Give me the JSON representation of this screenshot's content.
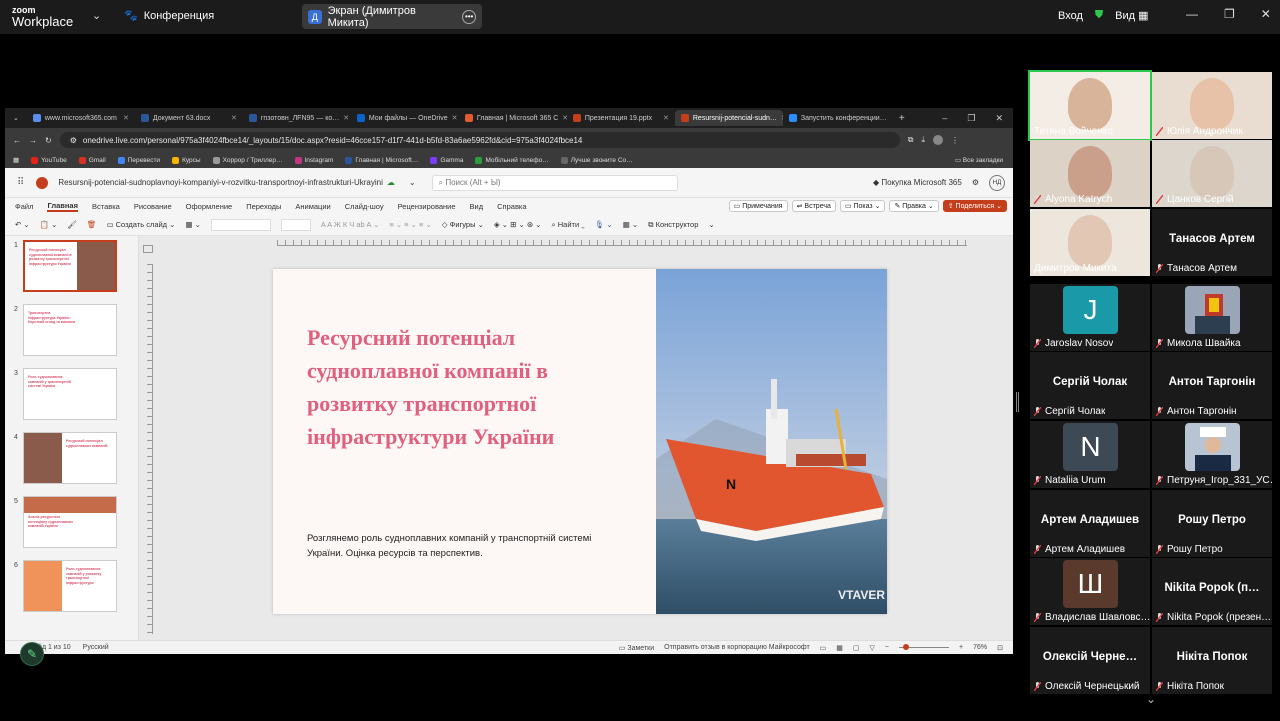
{
  "zoom": {
    "logo_line1": "zoom",
    "logo_line2": "Workplace",
    "conference_label": "Конференция",
    "screen_badge": "Д",
    "screen_share_label": "Экран (Димитров Микита)",
    "enter_label": "Вход",
    "view_label": "Вид"
  },
  "browser": {
    "tabs": [
      {
        "label": "www.microsoft365.com",
        "color": "#5b8def"
      },
      {
        "label": "Документ 63.docx",
        "color": "#2b579a"
      },
      {
        "label": "гпзотовн_ЛFN95 — ко…",
        "color": "#2b579a"
      },
      {
        "label": "Мои файлы — OneDrive",
        "color": "#0a63c9"
      },
      {
        "label": "Главная | Microsoft 365 С",
        "color": "#e35b2c"
      },
      {
        "label": "Презентация 19.pptx",
        "color": "#c43e1c"
      },
      {
        "label": "Resursnij-potencial-sudn…",
        "color": "#c43e1c"
      },
      {
        "label": "Запустить конференции…",
        "color": "#2d8cff"
      }
    ],
    "url": "onedrive.live.com/personal/975a3f4024fbce14/_layouts/15/doc.aspx?resid=46cce157-d1f7-441d-b5fd-83a6ae5962fd&cid=975a3f4024fbce14",
    "bookmarks": [
      "YouTube",
      "Gmail",
      "Перевести",
      "Курсы",
      "Хоррор / Триллер…",
      "Instagram",
      "Главная | Microsoft…",
      "Gamma",
      "Мобільний телефо…",
      "Лучше звоните Со…"
    ],
    "all_bookmarks": "Все закладки"
  },
  "office": {
    "doc_title": "Resursnij-potencial-sudnoplavnoyi-kompaniyi-v-rozvitku-transportnoyi-infrastrukturi-Ukrayini",
    "search_placeholder": "Поиск (Alt + Ы)",
    "buy_label": "Покупка Microsoft 365",
    "user_initials": "НД",
    "menu": [
      "Файл",
      "Главная",
      "Вставка",
      "Рисование",
      "Оформление",
      "Переходы",
      "Анимации",
      "Слайд-шоу",
      "Рецензирование",
      "Вид",
      "Справка"
    ],
    "notes_btn": "Примечания",
    "meeting_btn": "Встреча",
    "show_btn": "Показ",
    "edit_btn": "Правка",
    "share_btn": "Поделиться",
    "create_slide": "Создать слайд",
    "shapes": "Фигуры",
    "find": "Найти",
    "designer": "Конструктор",
    "status_slide": "Слайд 1 из 10",
    "status_lang": "Русский",
    "status_notes": "Заметки",
    "status_feedback": "Отправить отзыв в корпорацию Майкрософт",
    "zoom_level": "76%"
  },
  "slide": {
    "title": "Ресурсний потенціал судноплавної компанії в розвитку транспортної інфраструктури України",
    "subtitle": "Розглянемо роль судноплавних компаній у транспортній системі України. Оцінка ресурсів та перспектив.",
    "watermark": "VTAVER"
  },
  "thumbnails": [
    {
      "num": "1",
      "title": "Ресурсний потенціал судноплавної компанії в розвитку транспортної інфраструктури України"
    },
    {
      "num": "2",
      "title": "Транспортна інфраструктура України: Короткий огляд та виклики"
    },
    {
      "num": "3",
      "title": "Роль судноплавних компаній у транспортній системі України"
    },
    {
      "num": "4",
      "title": "Ресурсний потенціал судноплавних компаній"
    },
    {
      "num": "5",
      "title": "Аналіз ресурсного потенціалу судноплавних компаній України"
    },
    {
      "num": "6",
      "title": "Роль судноплавних компаній у розвитку транспортної інфраструктури"
    }
  ],
  "participants": [
    {
      "name": "Тетяна Войченко",
      "type": "video",
      "muted": false
    },
    {
      "name": "Юлія Андрончик",
      "type": "video",
      "muted": true
    },
    {
      "name": "Alyona Katrych",
      "type": "video",
      "muted": true
    },
    {
      "name": "Цанков Сергій",
      "type": "video",
      "muted": true
    },
    {
      "name": "Димитров Микита",
      "type": "video",
      "muted": false
    },
    {
      "name": "Танасов Артем",
      "big": "Танасов Артем",
      "type": "name",
      "muted": true
    },
    {
      "name": "Jaroslav Nosov",
      "letter": "J",
      "color": "#1a9aa8",
      "type": "avatar",
      "muted": true
    },
    {
      "name": "Микола Швайка",
      "type": "photo",
      "muted": true
    },
    {
      "name": "Сергій Чолак",
      "big": "Сергій Чолак",
      "type": "name",
      "muted": true
    },
    {
      "name": "Антон Таргонін",
      "big": "Антон Таргонін",
      "type": "name",
      "muted": true
    },
    {
      "name": "Nataliia Urum",
      "letter": "N",
      "color": "#3d4a55",
      "type": "avatar",
      "muted": true
    },
    {
      "name": "Петруня_Ігор_331_УС…",
      "type": "photo2",
      "muted": true
    },
    {
      "name": "Артем Аладишев",
      "big": "Артем Аладишев",
      "type": "name",
      "muted": true
    },
    {
      "name": "Рошу Петро",
      "big": "Рошу Петро",
      "type": "name",
      "muted": true
    },
    {
      "name": "Владислав Шавловс…",
      "letter": "Ш",
      "color": "#5b3a2e",
      "type": "avatar",
      "muted": true
    },
    {
      "name": "Nikita Popok (презен…",
      "big": "Nikita Popok  (п…",
      "type": "name",
      "muted": true
    },
    {
      "name": "Олексій Чернецький",
      "big": "Олексій Черне…",
      "type": "name",
      "muted": true
    },
    {
      "name": "Нікіта Попок",
      "big": "Нікіта Попок",
      "type": "name",
      "muted": true
    }
  ]
}
